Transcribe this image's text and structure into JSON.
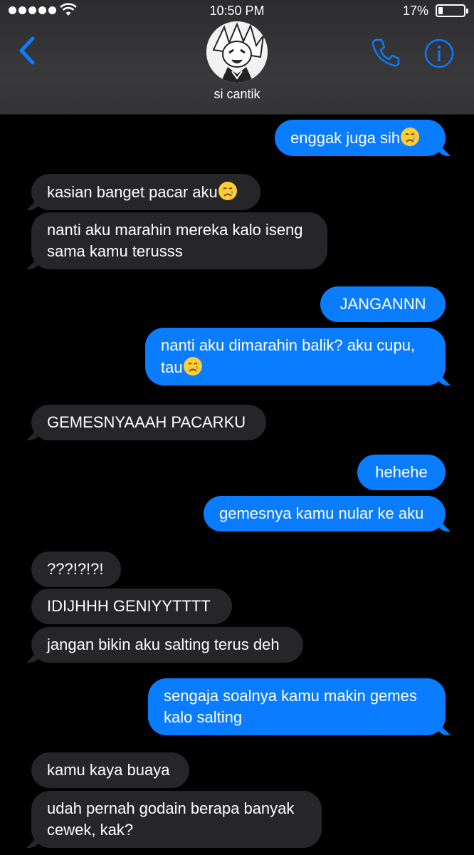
{
  "status_bar": {
    "time": "10:50 PM",
    "battery": "17%"
  },
  "header": {
    "contact_name": "si cantik"
  },
  "colors": {
    "sent_bubble": "#0a7cff",
    "received_bubble": "#262628",
    "accent": "#0a7cff"
  },
  "messages": [
    {
      "from": "me",
      "text": "enggak juga sih",
      "emoji": "crying-face"
    },
    {
      "from": "them",
      "text": "kasian banget pacar aku",
      "emoji": "crying-face"
    },
    {
      "from": "them",
      "text": "nanti aku marahin mereka kalo iseng sama kamu terusss"
    },
    {
      "from": "me",
      "text": "JANGANNN"
    },
    {
      "from": "me",
      "text": "nanti aku dimarahin balik? aku cupu, tau",
      "emoji": "crying-face"
    },
    {
      "from": "them",
      "text": "GEMESNYAAAH PACARKU"
    },
    {
      "from": "me",
      "text": "hehehe"
    },
    {
      "from": "me",
      "text": "gemesnya kamu nular ke aku"
    },
    {
      "from": "them",
      "text": "???!?!?!"
    },
    {
      "from": "them",
      "text": "IDIJHHH GENIYYTTTT"
    },
    {
      "from": "them",
      "text": "jangan bikin aku salting terus deh"
    },
    {
      "from": "me",
      "text": "sengaja soalnya kamu makin gemes kalo salting"
    },
    {
      "from": "them",
      "text": "kamu kaya buaya"
    },
    {
      "from": "them",
      "text": "udah pernah godain berapa banyak cewek, kak?"
    }
  ]
}
